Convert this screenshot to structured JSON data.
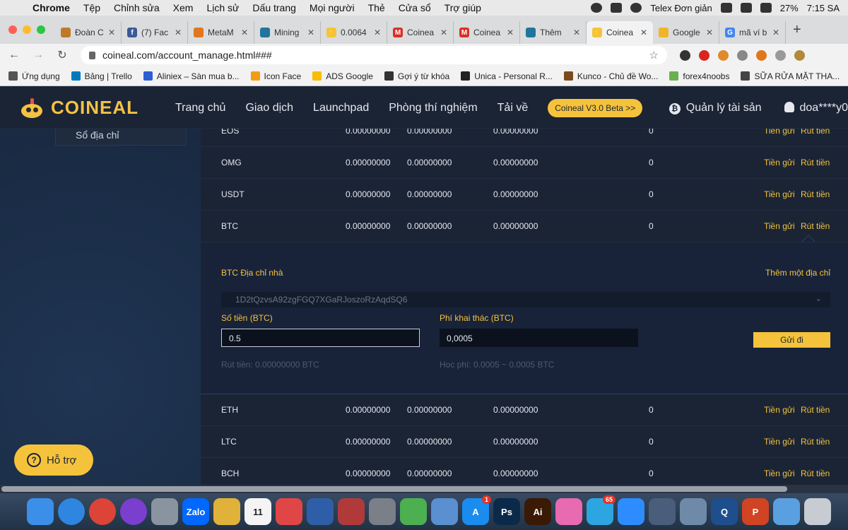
{
  "menubar": {
    "items": [
      "Chrome",
      "Tệp",
      "Chỉnh sửa",
      "Xem",
      "Lịch sử",
      "Dấu trang",
      "Mọi người",
      "Thẻ",
      "Cửa sổ",
      "Trợ giúp"
    ],
    "input_method": "Telex Đơn giản",
    "battery": "27%",
    "time": "7:15 SA"
  },
  "tabs": [
    {
      "label": "Đoàn C",
      "color": "#c0792a",
      "glyph": ""
    },
    {
      "label": "(7) Fac",
      "color": "#3b5998",
      "glyph": "f"
    },
    {
      "label": "MetaM",
      "color": "#e2761b",
      "glyph": ""
    },
    {
      "label": "Mining",
      "color": "#21759b",
      "glyph": ""
    },
    {
      "label": "0.0064",
      "color": "#f5c33b",
      "glyph": "⚡"
    },
    {
      "label": "Coinea",
      "color": "#d93025",
      "glyph": "M"
    },
    {
      "label": "Coinea",
      "color": "#d93025",
      "glyph": "M"
    },
    {
      "label": "Thêm",
      "color": "#21759b",
      "glyph": ""
    },
    {
      "label": "Coinea",
      "color": "#f5c33b",
      "glyph": "⚡"
    },
    {
      "label": "Google",
      "color": "#f0b429",
      "glyph": ""
    },
    {
      "label": "mã ví b",
      "color": "#4285f4",
      "glyph": "G"
    }
  ],
  "active_tab_index": 8,
  "address": {
    "url": "coineal.com/account_manage.html###"
  },
  "bookmarks": [
    {
      "label": "Ứng dụng",
      "color": "#555555"
    },
    {
      "label": "Bảng | Trello",
      "color": "#0079bf"
    },
    {
      "label": "Aliniex – Sàn mua b...",
      "color": "#2c5fd4"
    },
    {
      "label": "Icon Face",
      "color": "#f39c12"
    },
    {
      "label": "ADS Google",
      "color": "#fbbc04"
    },
    {
      "label": "Gợi ý từ khóa",
      "color": "#333333"
    },
    {
      "label": "Unica - Personal R...",
      "color": "#222222"
    },
    {
      "label": "Kunco - Chủ đề Wo...",
      "color": "#7a4a1e"
    },
    {
      "label": "forex4noobs",
      "color": "#6ab04c"
    },
    {
      "label": "SỮA RỬA MẶT THA...",
      "color": "#444444"
    }
  ],
  "header": {
    "logo": "COINEAL",
    "nav": [
      "Trang chủ",
      "Giao dịch",
      "Launchpad",
      "Phòng thí nghiệm",
      "Tải về"
    ],
    "beta": "Coineal V3.0 Beta >>",
    "asset_mgmt": "Quản lý tài sản",
    "user": "doa****y0"
  },
  "sidebar": {
    "item": "Sổ địa chỉ"
  },
  "rows_above": [
    {
      "coin": "EOS",
      "v1": "0.00000000",
      "v2": "0.00000000",
      "v3": "0.00000000",
      "v4": "0",
      "deposit": "Tiền gửi",
      "withdraw": "Rút tiền"
    },
    {
      "coin": "OMG",
      "v1": "0.00000000",
      "v2": "0.00000000",
      "v3": "0.00000000",
      "v4": "0",
      "deposit": "Tiền gửi",
      "withdraw": "Rút tiền"
    },
    {
      "coin": "USDT",
      "v1": "0.00000000",
      "v2": "0.00000000",
      "v3": "0.00000000",
      "v4": "0",
      "deposit": "Tiền gửi",
      "withdraw": "Rút tiền"
    },
    {
      "coin": "BTC",
      "v1": "0.00000000",
      "v2": "0.00000000",
      "v3": "0.00000000",
      "v4": "0",
      "deposit": "Tiền gửi",
      "withdraw": "Rút tiền"
    }
  ],
  "withdraw_panel": {
    "address_label": "BTC Địa chỉ nhà",
    "add_address": "Thêm một địa chỉ",
    "address_value": "1D2tQzvsA92zgFGQ7XGaRJoszoRzAqdSQ6",
    "amount_label": "Số tiền  (BTC)",
    "amount_value": "0.5",
    "fee_label": "Phí khai thác  (BTC)",
    "fee_value": "0,0005",
    "send": "Gửi đi",
    "withdraw_note": "Rút tiền:  0.00000000   BTC",
    "fee_note": "Học phí:  0.0005 ~ 0.0005   BTC"
  },
  "rows_below": [
    {
      "coin": "ETH",
      "v1": "0.00000000",
      "v2": "0.00000000",
      "v3": "0.00000000",
      "v4": "0",
      "deposit": "Tiền gửi",
      "withdraw": "Rút tiền"
    },
    {
      "coin": "LTC",
      "v1": "0.00000000",
      "v2": "0.00000000",
      "v3": "0.00000000",
      "v4": "0",
      "deposit": "Tiền gửi",
      "withdraw": "Rút tiền"
    },
    {
      "coin": "BCH",
      "v1": "0.00000000",
      "v2": "0.00000000",
      "v3": "0.00000000",
      "v4": "0",
      "deposit": "Tiền gửi",
      "withdraw": "Rút tiền"
    }
  ],
  "help": {
    "label": "Hỗ trợ"
  },
  "dock": [
    {
      "name": "finder-icon",
      "color": "#3b8fe8",
      "text": ""
    },
    {
      "name": "safari-icon",
      "color": "#2f86e0",
      "text": ""
    },
    {
      "name": "chrome-icon",
      "color": "#db4437",
      "text": ""
    },
    {
      "name": "siri-icon",
      "color": "#7a3fcf",
      "text": ""
    },
    {
      "name": "launchpad-icon",
      "color": "#8a93a0",
      "text": ""
    },
    {
      "name": "zalo-icon",
      "color": "#0068ff",
      "text": "Zalo"
    },
    {
      "name": "notes-icon",
      "color": "#e0b23a",
      "text": ""
    },
    {
      "name": "calendar-icon",
      "color": "#f4f4f4",
      "text": "11"
    },
    {
      "name": "app-icon",
      "color": "#e04646",
      "text": ""
    },
    {
      "name": "app-icon",
      "color": "#2e5ea8",
      "text": ""
    },
    {
      "name": "photos-icon",
      "color": "#b03a3a",
      "text": ""
    },
    {
      "name": "preferences-icon",
      "color": "#7b7f87",
      "text": ""
    },
    {
      "name": "app-icon",
      "color": "#4caf50",
      "text": ""
    },
    {
      "name": "preview-icon",
      "color": "#5a8fd0",
      "text": ""
    },
    {
      "name": "appstore-icon",
      "color": "#1a8cf0",
      "text": "A",
      "badge": "1"
    },
    {
      "name": "photoshop-icon",
      "color": "#0b2a4a",
      "text": "Ps"
    },
    {
      "name": "illustrator-icon",
      "color": "#3a1a05",
      "text": "Ai"
    },
    {
      "name": "folder-icon",
      "color": "#e86ab0",
      "text": ""
    },
    {
      "name": "telegram-icon",
      "color": "#2ca5e0",
      "text": "",
      "badge": "65"
    },
    {
      "name": "zoom-icon",
      "color": "#2d8cff",
      "text": ""
    },
    {
      "name": "atom-icon",
      "color": "#4a5d7a",
      "text": ""
    },
    {
      "name": "app-icon",
      "color": "#6e8aa8",
      "text": ""
    },
    {
      "name": "quicktime-icon",
      "color": "#1e4e8c",
      "text": "Q"
    },
    {
      "name": "powerpoint-icon",
      "color": "#d04423",
      "text": "P"
    },
    {
      "name": "folder-icon",
      "color": "#5aa0e0",
      "text": ""
    },
    {
      "name": "trash-icon",
      "color": "#c7ccd3",
      "text": ""
    }
  ]
}
